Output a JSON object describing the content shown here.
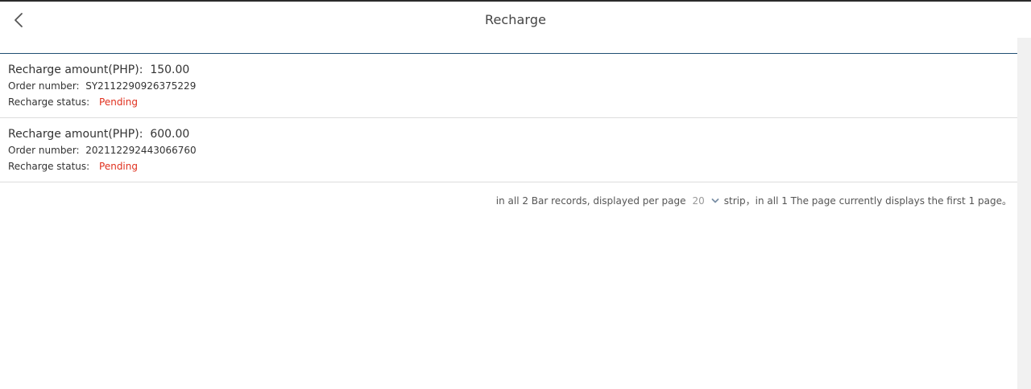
{
  "header": {
    "title": "Recharge",
    "back_icon": "chevron-left-icon"
  },
  "records": [
    {
      "amount_label": "Recharge amount(PHP)",
      "amount_value": "150.00",
      "order_label": "Order number",
      "order_value": "SY2112290926375229",
      "status_label": "Recharge status",
      "status_value": "Pending"
    },
    {
      "amount_label": "Recharge amount(PHP)",
      "amount_value": "600.00",
      "order_label": "Order number",
      "order_value": "202112292443066760",
      "status_label": "Recharge status",
      "status_value": "Pending"
    }
  ],
  "pager": {
    "prefix": "in all 2 Bar records, displayed per page",
    "page_size": "20",
    "suffix": "strip，in all 1 The page currently displays the first 1 page。"
  },
  "colors": {
    "status_pending": "#e0301e",
    "list_top_border": "#1f4f73"
  }
}
